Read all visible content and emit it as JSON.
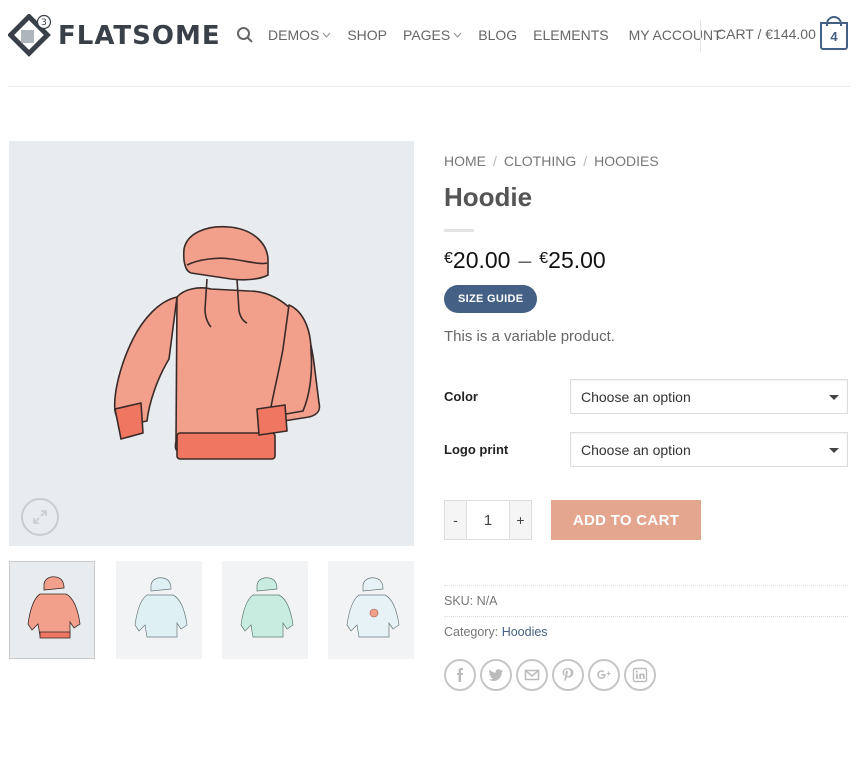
{
  "brand": {
    "name": "FLATSOME",
    "version_badge": "3"
  },
  "nav": {
    "items": [
      {
        "label": "DEMOS",
        "has_dropdown": true
      },
      {
        "label": "SHOP",
        "has_dropdown": false
      },
      {
        "label": "PAGES",
        "has_dropdown": true
      },
      {
        "label": "BLOG",
        "has_dropdown": false
      },
      {
        "label": "ELEMENTS",
        "has_dropdown": false
      },
      {
        "label": "MY ACCOUNT",
        "has_dropdown": false
      }
    ],
    "cart_label": "CART / €144.00",
    "cart_count": "4"
  },
  "breadcrumb": [
    "HOME",
    "CLOTHING",
    "HOODIES"
  ],
  "product": {
    "title": "Hoodie",
    "price_min": "20.00",
    "price_max": "25.00",
    "currency": "€",
    "size_guide": "SIZE GUIDE",
    "description": "This is a variable product.",
    "variations": [
      {
        "label": "Color",
        "placeholder": "Choose an option"
      },
      {
        "label": "Logo print",
        "placeholder": "Choose an option"
      }
    ],
    "quantity": "1",
    "minus": "-",
    "plus": "+",
    "add_to_cart": "ADD TO CART",
    "sku_label": "SKU:",
    "sku_value": "N/A",
    "category_label": "Category:",
    "category_value": "Hoodies"
  },
  "share_icons": [
    "facebook-icon",
    "twitter-icon",
    "email-icon",
    "pinterest-icon",
    "google-plus-icon",
    "linkedin-icon"
  ],
  "colors": {
    "primary": "#446084",
    "add_to_cart": "#e5a690",
    "hoodie_coral": "#f29a86",
    "hoodie_blue": "#dff0f4",
    "hoodie_green": "#c9ece1"
  }
}
